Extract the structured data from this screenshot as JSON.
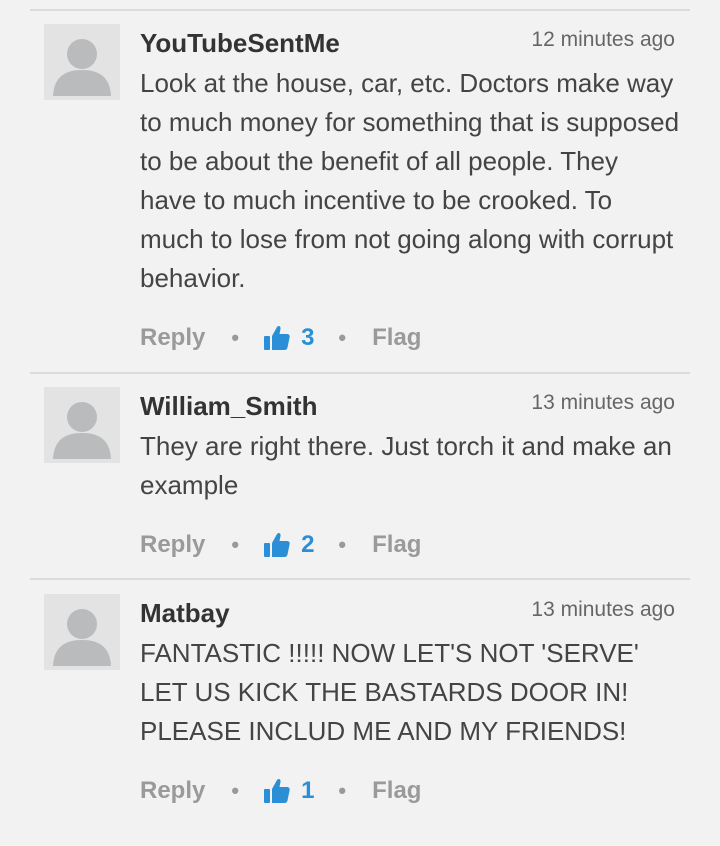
{
  "comments": [
    {
      "author": "YouTubeSentMe",
      "time": "12 minutes ago",
      "text": "Look at the house, car, etc. Doctors make way to much money for something that is supposed to be about the benefit of all people. They have to much incentive to be crooked. To much to lose from not going along with corrupt behavior.",
      "reply_label": "Reply",
      "likes": "3",
      "flag_label": "Flag"
    },
    {
      "author": "William_Smith",
      "time": "13 minutes ago",
      "text": "They are right there. Just torch it and make an example",
      "reply_label": "Reply",
      "likes": "2",
      "flag_label": "Flag"
    },
    {
      "author": "Matbay",
      "time": "13 minutes ago",
      "text": "FANTASTIC !!!!! NOW LET'S NOT 'SERVE' LET US KICK THE BASTARDS DOOR IN! PLEASE INCLUD ME AND MY FRIENDS!",
      "reply_label": "Reply",
      "likes": "1",
      "flag_label": "Flag"
    }
  ],
  "colors": {
    "background": "#f2f2f2",
    "accent": "#2a8fd6",
    "muted": "#9a9a9a"
  },
  "icons": {
    "avatar": "user-silhouette-icon",
    "like": "thumbs-up-icon"
  }
}
